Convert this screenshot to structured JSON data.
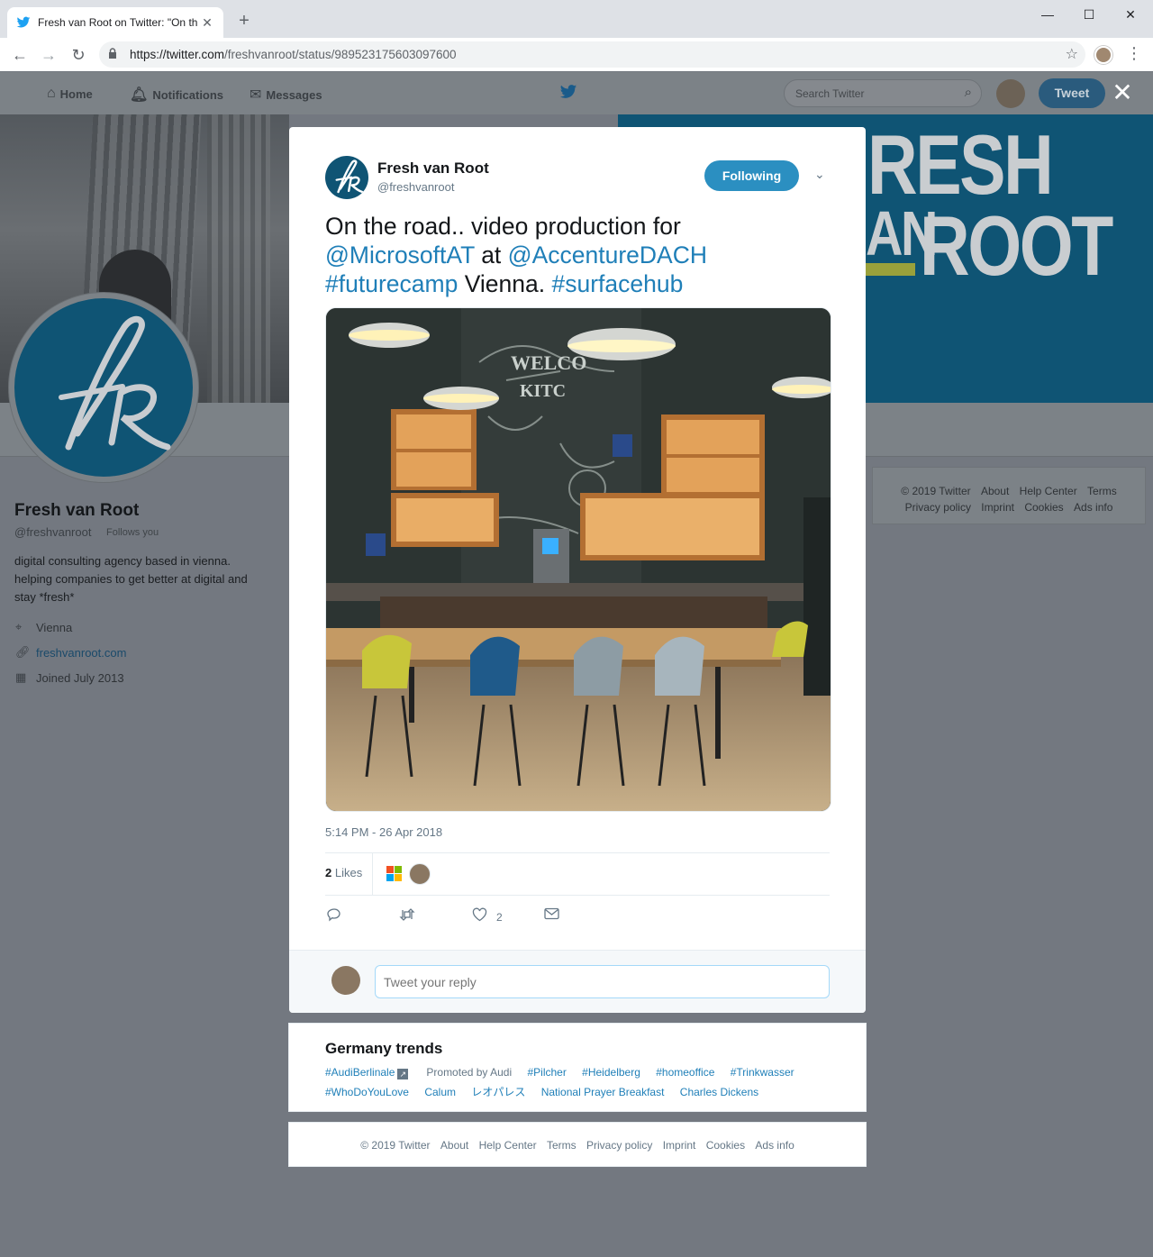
{
  "browser": {
    "tab_title": "Fresh van Root on Twitter: \"On th",
    "tab_close": "✕",
    "new_tab": "+",
    "url_host": "https://twitter.com",
    "url_path": "/freshvanroot/status/989523175603097600",
    "window_buttons": [
      "—",
      "☐",
      "✕"
    ]
  },
  "twitter_nav": {
    "home": "Home",
    "notifications": "Notifications",
    "messages": "Messages",
    "search_placeholder": "Search Twitter",
    "tweet_button": "Tweet",
    "close": "✕"
  },
  "banner": {
    "word1": "RESH",
    "word2": "AN",
    "word3": "ROOT"
  },
  "profile": {
    "name": "Fresh van Root",
    "handle": "@freshvanroot",
    "follows_you": "Follows you",
    "bio": "digital consulting agency based in vienna. helping companies to get better at digital and stay *fresh*",
    "location": "Vienna",
    "website": "freshvanroot.com",
    "joined": "Joined July 2013"
  },
  "side_footer": {
    "row1": [
      "© 2019 Twitter",
      "About",
      "Help Center",
      "Terms"
    ],
    "row2": [
      "Privacy policy",
      "Imprint",
      "Cookies",
      "Ads info"
    ]
  },
  "tweet": {
    "author_name": "Fresh van Root",
    "author_handle": "@freshvanroot",
    "follow_state": "Following",
    "text_plain_1": "On the road.. video production for",
    "mention_1": "@MicrosoftAT",
    "text_plain_2": "at",
    "mention_2": "@AccentureDACH",
    "hashtag_1": "#futurecamp",
    "text_plain_3": "Vienna.",
    "hashtag_2": "#surfacehub",
    "timestamp": "5:14 PM - 26 Apr 2018",
    "likes_count": "2",
    "likes_label": "Likes",
    "like_action_count": "2",
    "reply_placeholder": "Tweet your reply",
    "photo_text_1": "WELCO",
    "photo_text_2": "KITC"
  },
  "trends": {
    "title": "Germany trends",
    "row1": [
      "#AudiBerlinale",
      "Promoted by Audi",
      "#Pilcher",
      "#Heidelberg",
      "#homeoffice",
      "#Trinkwasser"
    ],
    "row2": [
      "#WhoDoYouLove",
      "Calum",
      "レオパレス",
      "National Prayer Breakfast",
      "Charles Dickens"
    ]
  },
  "bottom_footer": [
    "© 2019 Twitter",
    "About",
    "Help Center",
    "Terms",
    "Privacy policy",
    "Imprint",
    "Cookies",
    "Ads info"
  ],
  "colors": {
    "accent": "#1f7fb8",
    "brand_blue": "#0f5474",
    "follow_button": "#2b8fc1"
  }
}
